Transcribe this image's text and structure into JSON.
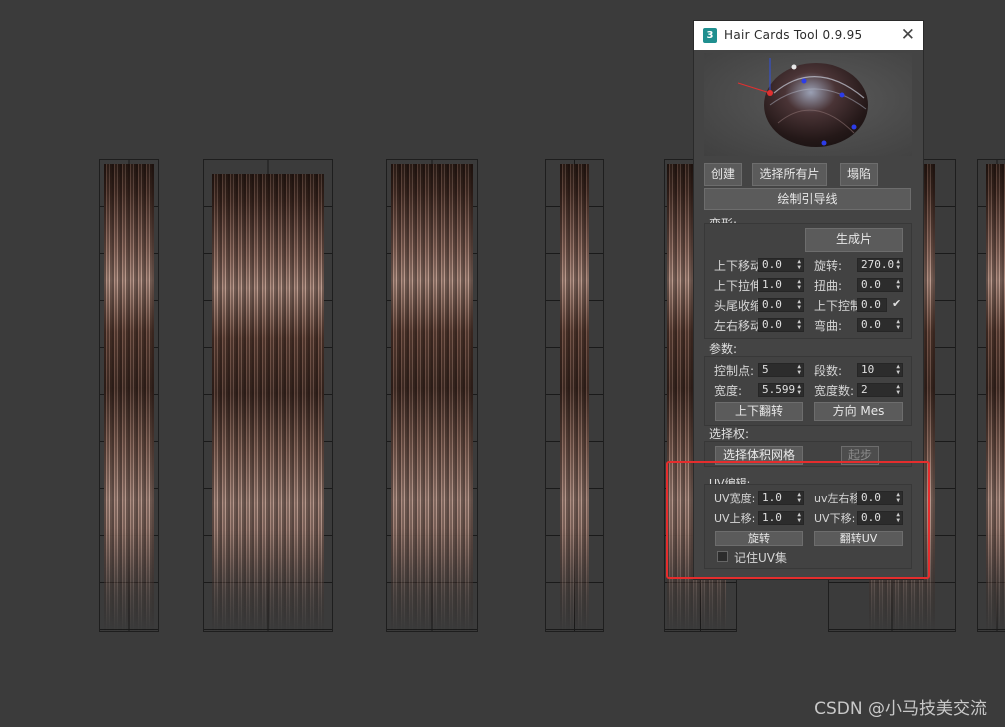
{
  "window": {
    "title": "Hair Cards Tool 0.9.95",
    "app_icon_text": "3"
  },
  "top_buttons": {
    "create": "创建",
    "select_all": "选择所有片",
    "collapse": "塌陷",
    "draw_guide": "绘制引导线"
  },
  "deform": {
    "label": "变形:",
    "generate": "生成片",
    "rows": [
      {
        "left_label": "上下移动",
        "left_value": "0.0",
        "right_label": "旋转:",
        "right_value": "270.0"
      },
      {
        "left_label": "上下拉伸",
        "left_value": "1.0",
        "right_label": "扭曲:",
        "right_value": "0.0"
      },
      {
        "left_label": "头尾收缩",
        "left_value": "0.0",
        "right_label": "上下控制",
        "right_value": "0.0"
      },
      {
        "left_label": "左右移动",
        "left_value": "0.0",
        "right_label": "弯曲:",
        "right_value": "0.0"
      }
    ]
  },
  "params": {
    "label": "参数:",
    "control_points_label": "控制点:",
    "control_points": "5",
    "segments_label": "段数:",
    "segments": "10",
    "width_label": "宽度:",
    "width": "5.599",
    "width_count_label": "宽度数:",
    "width_count": "2",
    "flip_vertical": "上下翻转",
    "direction": "方向 Mes"
  },
  "select": {
    "label": "选择权:",
    "select_volume_mesh": "选择体积网格",
    "start": "起步"
  },
  "uv": {
    "label": "UV编辑:",
    "uv_width_label": "UV宽度:",
    "uv_width": "1.0",
    "uv_lr_label": "uv左右移",
    "uv_lr": "0.0",
    "uv_up_label": "UV上移:",
    "uv_up": "1.0",
    "uv_down_label": "UV下移:",
    "uv_down": "0.0",
    "rotate": "旋转",
    "flip_uv": "翻转UV",
    "remember_uv_label": "记住UV集"
  },
  "watermark": "CSDN @小马技美交流",
  "colors": {
    "highlight": "#e52d2d",
    "viewport_bg": "#3b3b3b",
    "dialog_bg": "#444444"
  }
}
